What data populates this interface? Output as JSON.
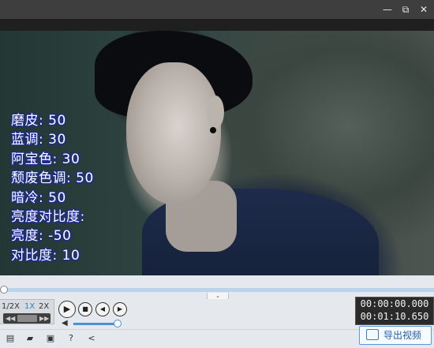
{
  "window": {
    "minimize_glyph": "—",
    "restore_glyph": "⧉",
    "close_glyph": "✕"
  },
  "overlay_lines": [
    "磨皮: 50",
    "蓝调: 30",
    "阿宝色: 30",
    "颓废色调: 50",
    "暗冷: 50",
    "亮度对比度:",
    "亮度: -50",
    "对比度: 10"
  ],
  "speed": {
    "options": [
      "1/2X",
      "1X",
      "2X"
    ],
    "selected": "1X",
    "rewind_glyph": "◀◀",
    "forward_glyph": "▶▶"
  },
  "playback": {
    "progress_fraction": 0.0
  },
  "controls": {
    "play_glyph": "▶",
    "stop_glyph": "■",
    "prev_glyph": "◀",
    "next_glyph": "▶",
    "volume_glyph": "◀",
    "volume_fraction": 0.92
  },
  "time": {
    "current": "00:00:00.000",
    "total": "00:01:10.650"
  },
  "bottom_tools": [
    {
      "name": "new-project-icon",
      "glyph": "▤"
    },
    {
      "name": "open-folder-icon",
      "glyph": "▰"
    },
    {
      "name": "save-icon",
      "glyph": "▣"
    },
    {
      "name": "help-icon",
      "glyph": "?"
    },
    {
      "name": "share-icon",
      "glyph": "<"
    }
  ],
  "export": {
    "label": "导出视频"
  },
  "collapse_glyph": "⌄",
  "colors": {
    "accent": "#2b7fd4",
    "titlebar": "#3e3e3e",
    "panel": "#e5e8ec"
  }
}
